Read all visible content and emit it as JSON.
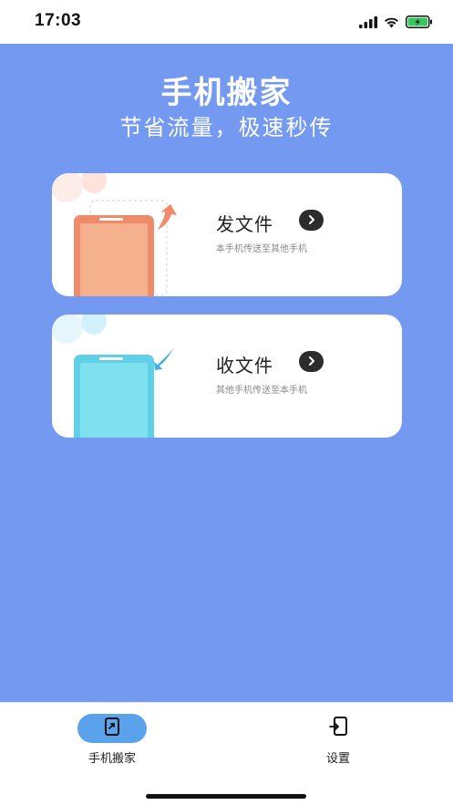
{
  "status_bar": {
    "time": "17:03"
  },
  "header": {
    "title": "手机搬家",
    "subtitle": "节省流量，极速秒传"
  },
  "cards": {
    "send": {
      "title": "发文件",
      "description": "本手机传送至其他手机"
    },
    "receive": {
      "title": "收文件",
      "description": "其他手机传送至本手机"
    }
  },
  "tab_bar": {
    "home_label": "手机搬家",
    "settings_label": "设置"
  },
  "colors": {
    "background": "#7499f0",
    "accent": "#5aa3ec",
    "send_phone": "#ef8a6a",
    "receive_phone": "#5fd0e8"
  }
}
